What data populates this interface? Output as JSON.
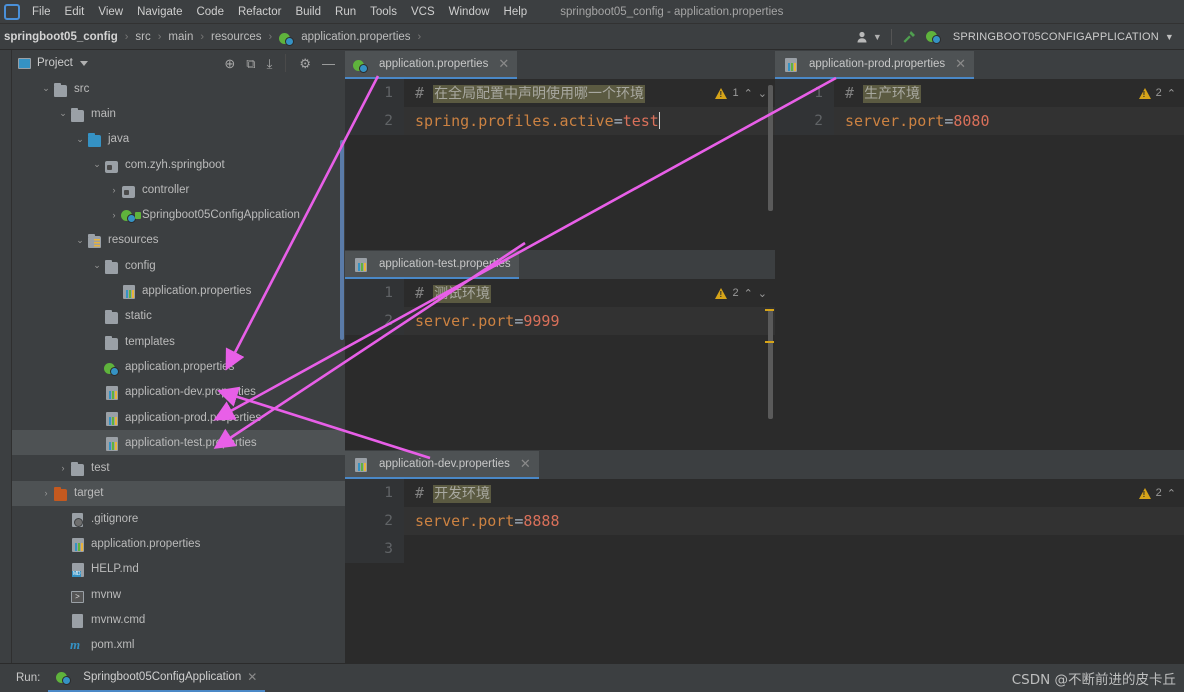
{
  "window": {
    "title": "springboot05_config - application.properties",
    "logo_icon": "intellij-idea-logo"
  },
  "menubar": {
    "items": [
      "File",
      "Edit",
      "View",
      "Navigate",
      "Code",
      "Refactor",
      "Build",
      "Run",
      "Tools",
      "VCS",
      "Window",
      "Help"
    ]
  },
  "navbar": {
    "crumbs": [
      "springboot05_config",
      "src",
      "main",
      "resources",
      "application.properties"
    ],
    "separator": "›",
    "crumb_file_icon": "spring-properties-icon",
    "user_icon": "user-avatar-icon",
    "build_icon": "hammer-icon",
    "run_config": {
      "icon": "spring-boot-run-icon",
      "label": "SPRINGBOOT05CONFIGAPPLICATION",
      "dropdown_icon": "chevron-down-icon"
    }
  },
  "project_panel": {
    "title": "Project",
    "title_icon": "project-view-icon",
    "dropdown_icon": "chevron-down-icon",
    "tools": [
      {
        "name": "locate-icon",
        "glyph": "⊕"
      },
      {
        "name": "expand-all-icon",
        "glyph": "⧉"
      },
      {
        "name": "collapse-all-icon",
        "glyph": "⤓"
      },
      {
        "name": "settings-gear-icon",
        "glyph": "⚙"
      },
      {
        "name": "hide-panel-icon",
        "glyph": "—"
      }
    ],
    "tree": [
      {
        "label": "src",
        "indent": 1,
        "arrow": "down",
        "icon": "folder-icon",
        "selected": false
      },
      {
        "label": "main",
        "indent": 2,
        "arrow": "down",
        "icon": "folder-icon",
        "selected": false
      },
      {
        "label": "java",
        "indent": 3,
        "arrow": "down",
        "icon": "folder-blue-icon",
        "selected": false
      },
      {
        "label": "com.zyh.springboot",
        "indent": 4,
        "arrow": "down",
        "icon": "package-icon",
        "selected": false
      },
      {
        "label": "controller",
        "indent": 5,
        "arrow": "right",
        "icon": "package-icon",
        "selected": false
      },
      {
        "label": "Springboot05ConfigApplication",
        "indent": 5,
        "arrow": "right",
        "icon": "spring-class-icon",
        "selected": false
      },
      {
        "label": "resources",
        "indent": 3,
        "arrow": "down",
        "icon": "folder-resources-icon",
        "selected": false
      },
      {
        "label": "config",
        "indent": 4,
        "arrow": "down",
        "icon": "folder-icon",
        "selected": false
      },
      {
        "label": "application.properties",
        "indent": 5,
        "arrow": "none",
        "icon": "properties-file-icon",
        "selected": false
      },
      {
        "label": "static",
        "indent": 4,
        "arrow": "none",
        "icon": "folder-icon",
        "selected": false
      },
      {
        "label": "templates",
        "indent": 4,
        "arrow": "none",
        "icon": "folder-icon",
        "selected": false
      },
      {
        "label": "application.properties",
        "indent": 4,
        "arrow": "none",
        "icon": "spring-properties-icon",
        "selected": false
      },
      {
        "label": "application-dev.properties",
        "indent": 4,
        "arrow": "none",
        "icon": "properties-file-icon",
        "selected": false
      },
      {
        "label": "application-prod.properties",
        "indent": 4,
        "arrow": "none",
        "icon": "properties-file-icon",
        "selected": false
      },
      {
        "label": "application-test.properties",
        "indent": 4,
        "arrow": "none",
        "icon": "properties-file-icon",
        "selected": true
      },
      {
        "label": "test",
        "indent": 2,
        "arrow": "right",
        "icon": "folder-icon",
        "selected": false
      },
      {
        "label": "target",
        "indent": 1,
        "arrow": "right",
        "icon": "folder-orange-icon",
        "selected": true
      },
      {
        "label": ".gitignore",
        "indent": 2,
        "arrow": "none",
        "icon": "gitignore-file-icon",
        "selected": false
      },
      {
        "label": "application.properties",
        "indent": 2,
        "arrow": "none",
        "icon": "properties-file-icon",
        "selected": false
      },
      {
        "label": "HELP.md",
        "indent": 2,
        "arrow": "none",
        "icon": "markdown-file-icon",
        "selected": false
      },
      {
        "label": "mvnw",
        "indent": 2,
        "arrow": "none",
        "icon": "shell-script-icon",
        "selected": false
      },
      {
        "label": "mvnw.cmd",
        "indent": 2,
        "arrow": "none",
        "icon": "cmd-file-icon",
        "selected": false
      },
      {
        "label": "pom.xml",
        "indent": 2,
        "arrow": "none",
        "icon": "maven-file-icon",
        "selected": false
      }
    ]
  },
  "editors": [
    {
      "id": "main",
      "tab": {
        "label": "application.properties",
        "icon": "spring-properties-icon",
        "close_icon": "close-icon"
      },
      "warning": {
        "icon": "warning-triangle-icon",
        "count": "1",
        "up_icon": "chevron-up-icon",
        "down_icon": "chevron-down-icon"
      },
      "lines": [
        {
          "no": "1",
          "hash": "#",
          "comment": "在全局配置中声明使用哪一个环境",
          "key": "",
          "eq": "",
          "value": "",
          "caret": false
        },
        {
          "no": "2",
          "hash": "",
          "comment": "",
          "key": "spring.profiles.active",
          "eq": "=",
          "value": "test",
          "caret": true
        }
      ]
    },
    {
      "id": "prod",
      "tab": {
        "label": "application-prod.properties",
        "icon": "properties-file-icon",
        "close_icon": "close-icon"
      },
      "warning": {
        "icon": "warning-triangle-icon",
        "count": "2",
        "up_icon": "chevron-up-icon",
        "down_icon": ""
      },
      "lines": [
        {
          "no": "1",
          "hash": "#",
          "comment": "生产环境",
          "key": "",
          "eq": "",
          "value": "",
          "caret": false
        },
        {
          "no": "2",
          "hash": "",
          "comment": "",
          "key": "server.port",
          "eq": "=",
          "value": "8080",
          "caret": false
        }
      ]
    },
    {
      "id": "test",
      "tab": {
        "label": "application-test.properties",
        "icon": "properties-file-icon",
        "close_icon": ""
      },
      "warning": {
        "icon": "warning-triangle-icon",
        "count": "2",
        "up_icon": "chevron-up-icon",
        "down_icon": "chevron-down-icon"
      },
      "lines": [
        {
          "no": "1",
          "hash": "#",
          "comment": "测试环境",
          "key": "",
          "eq": "",
          "value": "",
          "caret": false
        },
        {
          "no": "2",
          "hash": "",
          "comment": "",
          "key": "server.port",
          "eq": "=",
          "value": "9999",
          "caret": false
        }
      ]
    },
    {
      "id": "dev",
      "tab": {
        "label": "application-dev.properties",
        "icon": "properties-file-icon",
        "close_icon": "close-icon"
      },
      "warning": {
        "icon": "warning-triangle-icon",
        "count": "2",
        "up_icon": "chevron-up-icon",
        "down_icon": ""
      },
      "lines": [
        {
          "no": "1",
          "hash": "#",
          "comment": "开发环境",
          "key": "",
          "eq": "",
          "value": "",
          "caret": false
        },
        {
          "no": "2",
          "hash": "",
          "comment": "",
          "key": "server.port",
          "eq": "=",
          "value": "8888",
          "caret": false
        },
        {
          "no": "3",
          "hash": "",
          "comment": "",
          "key": "",
          "eq": "",
          "value": "",
          "caret": false
        }
      ]
    }
  ],
  "runbar": {
    "label": "Run:",
    "tab_label": "Springboot05ConfigApplication",
    "tab_icon": "spring-boot-run-icon",
    "close_icon": "close-icon",
    "watermark": "CSDN @不断前进的皮卡丘"
  },
  "colors": {
    "accent_blue": "#4a88c7",
    "annotation_pink": "#e85fe8",
    "warning_yellow": "#d6a419",
    "value_red": "#d9705a",
    "key_orange": "#cc8242",
    "comment_highlight": "#5b5a41"
  }
}
